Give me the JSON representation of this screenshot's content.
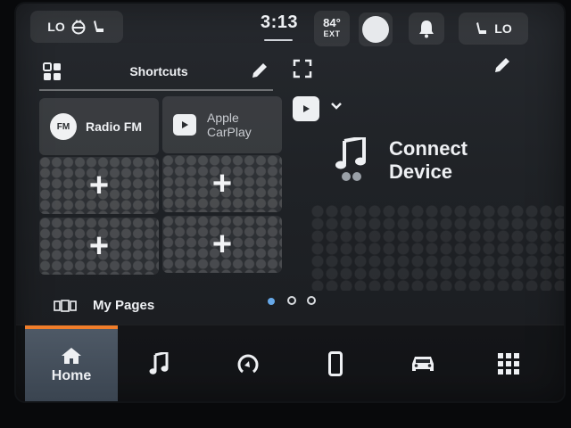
{
  "status_bar": {
    "climate_left": {
      "fan": "LO",
      "icons": [
        "steering-wheel-heat-icon",
        "seat-heat-icon"
      ]
    },
    "time": "3:13",
    "outside_temp": {
      "value": "84°",
      "label": "EXT"
    },
    "profile": "profile-avatar-icon",
    "notifications": "bell-icon",
    "climate_right": {
      "seat": "LO",
      "icons": [
        "seat-heat-icon"
      ]
    }
  },
  "shortcuts": {
    "title": "Shortcuts",
    "edit_icon": "pencil-icon",
    "tiles": [
      {
        "label": "Radio FM",
        "badge": "FM"
      },
      {
        "label_line1": "Apple",
        "label_line2": "CarPlay"
      },
      {
        "label": "+"
      },
      {
        "label": "+"
      },
      {
        "label": "+"
      },
      {
        "label": "+"
      }
    ]
  },
  "media": {
    "expand_icon": "expand-icon",
    "source_icon": "play-icon",
    "title_line1": "Connect",
    "title_line2": "Device"
  },
  "my_pages": {
    "label": "My Pages"
  },
  "pagination": {
    "count": 3,
    "active": 0
  },
  "nav": {
    "home_label": "Home",
    "items": [
      "home-icon",
      "music-icon",
      "dial-icon",
      "phone-icon",
      "car-icon",
      "apps-grid-icon"
    ]
  },
  "colors": {
    "accent": "#f07d2a",
    "active_dot": "#66a8e8"
  }
}
